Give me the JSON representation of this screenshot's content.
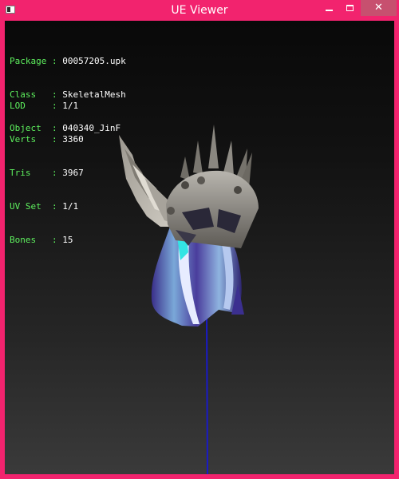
{
  "window": {
    "title": "UE Viewer",
    "close_label": "✕",
    "accent_color": "#f2236e"
  },
  "info": {
    "package_label": "Package",
    "package_value": "00057205.upk",
    "class_label": "Class",
    "class_value": "SkeletalMesh",
    "object_label": "Object",
    "object_value": "040340_JinF",
    "lod_label": "LOD",
    "lod_value": "1/1",
    "verts_label": "Verts",
    "verts_value": "3360",
    "tris_label": "Tris",
    "tris_value": "3967",
    "uvset_label": "UV Set",
    "uvset_value": "1/1",
    "bones_label": "Bones",
    "bones_value": "15",
    "separator": " : ",
    "label_color": "#5ef05e",
    "value_color": "#ffffff"
  },
  "viewport": {
    "model": "helmet-with-wings-and-hair-mesh"
  }
}
